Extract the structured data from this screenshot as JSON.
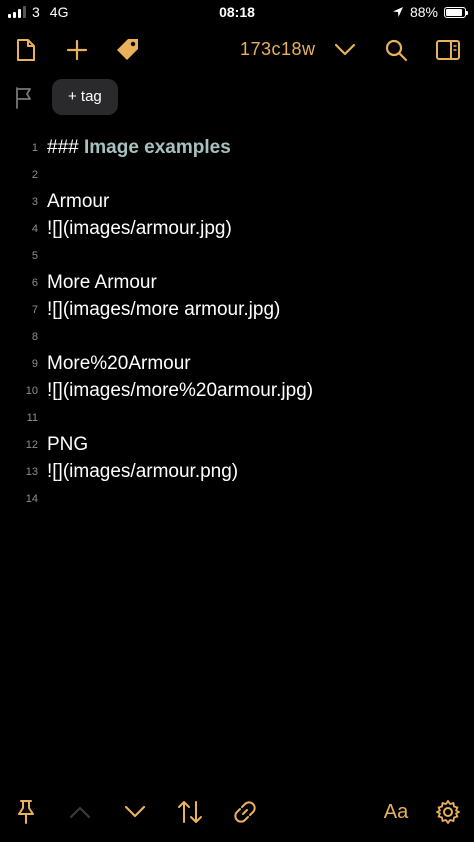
{
  "status_bar": {
    "carrier": "3",
    "network": "4G",
    "time": "08:18",
    "battery_percent": "88%",
    "battery_level": 0.88
  },
  "toolbar": {
    "note_id": "173c18w",
    "icons": [
      "document-icon",
      "plus-icon",
      "tag-icon",
      "chevron-down-icon",
      "search-icon",
      "sidebar-icon"
    ],
    "accent_color": "#e8b15a"
  },
  "tags": {
    "add_tag_label": "+ tag"
  },
  "editor": {
    "lines": [
      {
        "num": "1",
        "text": "### ",
        "heading": "Image examples"
      },
      {
        "num": "2",
        "text": ""
      },
      {
        "num": "3",
        "text": "Armour"
      },
      {
        "num": "4",
        "text": "![](images/armour.jpg)"
      },
      {
        "num": "5",
        "text": ""
      },
      {
        "num": "6",
        "text": "More Armour"
      },
      {
        "num": "7",
        "text": "![](images/more armour.jpg)"
      },
      {
        "num": "8",
        "text": ""
      },
      {
        "num": "9",
        "text": "More%20Armour"
      },
      {
        "num": "10",
        "text": "![](images/more%20armour.jpg)"
      },
      {
        "num": "11",
        "text": ""
      },
      {
        "num": "12",
        "text": "PNG"
      },
      {
        "num": "13",
        "text": "![](images/armour.png)"
      },
      {
        "num": "14",
        "text": ""
      }
    ]
  },
  "bottom_bar": {
    "font_label": "Aa",
    "icons": [
      "pin-icon",
      "chevron-up-icon",
      "chevron-down-icon",
      "sort-icon",
      "link-icon",
      "gear-icon"
    ]
  }
}
